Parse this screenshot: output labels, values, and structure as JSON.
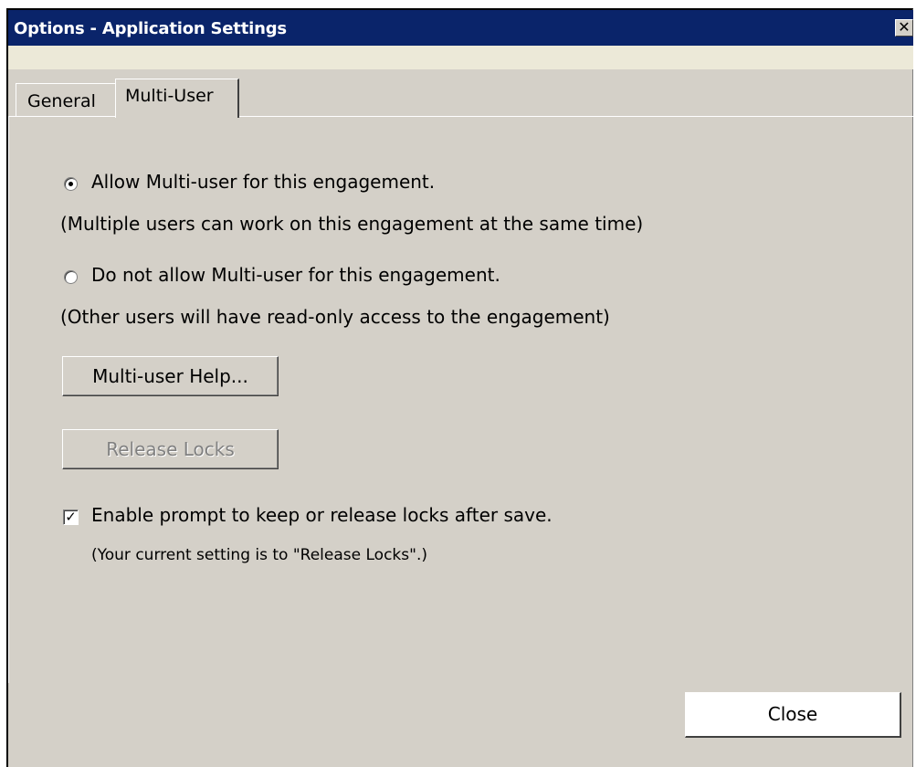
{
  "window": {
    "title": "Options - Application Settings",
    "close_glyph": "✕"
  },
  "tabs": [
    {
      "label": "General",
      "active": false
    },
    {
      "label": "Multi-User",
      "active": true
    }
  ],
  "multi_user": {
    "allow": {
      "label": "Allow Multi-user for this engagement.",
      "note": "(Multiple users can work on this engagement at the same time)",
      "selected": true
    },
    "disallow": {
      "label": "Do not allow Multi-user for this engagement.",
      "note": "(Other users will have read-only access to the engagement)",
      "selected": false
    },
    "help_button": "Multi-user Help...",
    "release_button": "Release Locks",
    "prompt_checkbox": {
      "label": "Enable prompt to keep or release locks after save.",
      "checked": true,
      "check_glyph": "✓"
    },
    "current_setting_note": "(Your current setting is to \"Release Locks\".)"
  },
  "footer": {
    "close_button": "Close"
  },
  "colors": {
    "titlebar": "#0a246a",
    "face": "#d4d0c8"
  }
}
